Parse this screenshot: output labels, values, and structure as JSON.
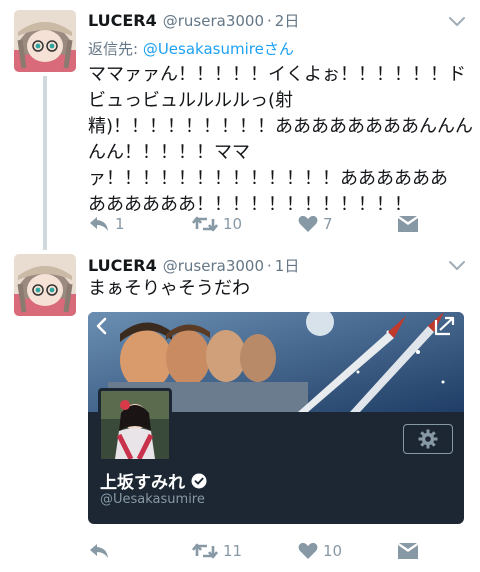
{
  "tweets": [
    {
      "name": "LUCER4",
      "handle": "@rusera3000",
      "dot": "·",
      "time": "2日",
      "reply_prefix": "返信先: ",
      "reply_mention": "@Uesakasumireさん",
      "lines": [
        "ママァァん！！！！！イくよぉ！！！！！！ド",
        "ビュっビュルルルルっ(射",
        "精)！！！！！！！！！ああああああああんんん",
        "んん！！！！！ママ",
        "ァ！！！！！！！！！！！！！ああああああ",
        "ああああああ！！！！！！！！！！！！"
      ],
      "reply_count": "1",
      "retweet_count": "10",
      "like_count": "7"
    },
    {
      "name": "LUCER4",
      "handle": "@rusera3000",
      "dot": "·",
      "time": "1日",
      "lines": [
        "まぁそりゃそうだわ"
      ],
      "card": {
        "name": "上坂すみれ",
        "handle": "@Uesakasumire"
      },
      "reply_count": "",
      "retweet_count": "11",
      "like_count": "10"
    }
  ],
  "colors": {
    "accent": "#1da1f2",
    "muted": "#657786",
    "icon": "#8899a6",
    "card_bg": "#1c2733"
  },
  "icons": [
    "reply-icon",
    "retweet-icon",
    "heart-icon",
    "envelope-icon",
    "chevron-down-icon",
    "back-arrow-icon",
    "share-icon",
    "gear-icon",
    "verified-badge-icon"
  ]
}
